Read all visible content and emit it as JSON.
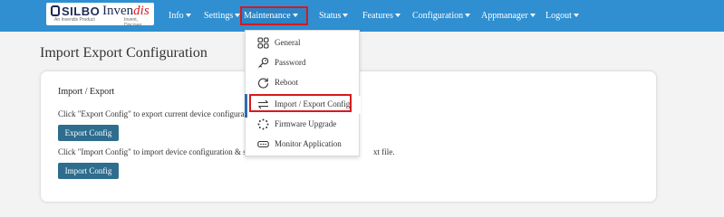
{
  "brand": {
    "silbo": "SILBO",
    "silbo_sub": "An Invendis Product",
    "invendis_main": "Inven",
    "invendis_accent": "dis",
    "invendis_tag": "Invent, Discover"
  },
  "nav": {
    "info": "Info",
    "settings": "Settings",
    "maintenance": "Maintenance",
    "status": "Status",
    "features": "Features",
    "configuration": "Configuration",
    "appmanager": "Appmanager",
    "logout": "Logout"
  },
  "dropdown": {
    "items": [
      {
        "label": "General",
        "icon": "grid-icon"
      },
      {
        "label": "Password",
        "icon": "key-icon"
      },
      {
        "label": "Reboot",
        "icon": "refresh-icon"
      },
      {
        "label": "Import / Export Config",
        "icon": "swap-arrows-icon"
      },
      {
        "label": "Firmware Upgrade",
        "icon": "dotted-circle-icon"
      },
      {
        "label": "Monitor Application",
        "icon": "monitor-icon"
      }
    ],
    "selected_index": 3
  },
  "page": {
    "title": "Import Export Configuration",
    "card_heading": "Import / Export",
    "export_text": "Click \"Export Config\" to export current device configurati",
    "export_button": "Export Config",
    "import_text_left": "Click \"Import Config\" to import device configuration & se",
    "import_text_right": "xt file.",
    "import_button": "Import Config"
  },
  "colors": {
    "navbar": "#2f8fd1",
    "button": "#2e6d8e",
    "highlight_border": "#d71920"
  }
}
